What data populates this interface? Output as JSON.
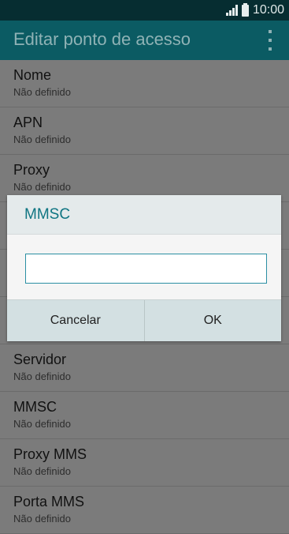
{
  "status_bar": {
    "time": "10:00"
  },
  "action_bar": {
    "title": "Editar ponto de acesso"
  },
  "list": {
    "items": [
      {
        "label": "Nome",
        "value": "Não definido"
      },
      {
        "label": "APN",
        "value": "Não definido"
      },
      {
        "label": "Proxy",
        "value": "Não definido"
      },
      {
        "label": "",
        "value": ""
      },
      {
        "label": "",
        "value": ""
      },
      {
        "label": "",
        "value": ""
      },
      {
        "label": "Servidor",
        "value": "Não definido"
      },
      {
        "label": "MMSC",
        "value": "Não definido"
      },
      {
        "label": "Proxy MMS",
        "value": "Não definido"
      },
      {
        "label": "Porta MMS",
        "value": "Não definido"
      }
    ]
  },
  "dialog": {
    "title": "MMSC",
    "input_value": "",
    "cancel_label": "Cancelar",
    "ok_label": "OK"
  }
}
